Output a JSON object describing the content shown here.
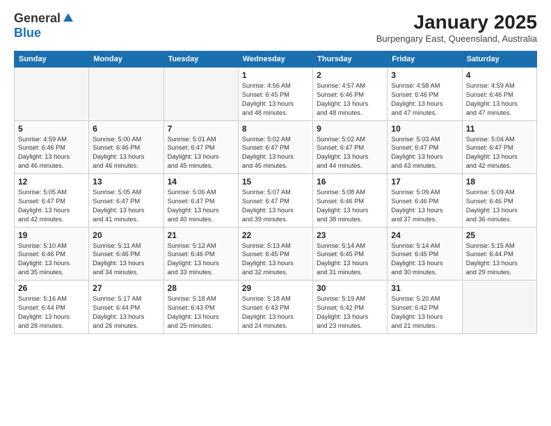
{
  "logo": {
    "general": "General",
    "blue": "Blue"
  },
  "title": "January 2025",
  "location": "Burpengary East, Queensland, Australia",
  "headers": [
    "Sunday",
    "Monday",
    "Tuesday",
    "Wednesday",
    "Thursday",
    "Friday",
    "Saturday"
  ],
  "weeks": [
    [
      {
        "day": "",
        "info": ""
      },
      {
        "day": "",
        "info": ""
      },
      {
        "day": "",
        "info": ""
      },
      {
        "day": "1",
        "info": "Sunrise: 4:56 AM\nSunset: 6:45 PM\nDaylight: 13 hours\nand 48 minutes."
      },
      {
        "day": "2",
        "info": "Sunrise: 4:57 AM\nSunset: 6:46 PM\nDaylight: 13 hours\nand 48 minutes."
      },
      {
        "day": "3",
        "info": "Sunrise: 4:58 AM\nSunset: 6:46 PM\nDaylight: 13 hours\nand 47 minutes."
      },
      {
        "day": "4",
        "info": "Sunrise: 4:59 AM\nSunset: 6:46 PM\nDaylight: 13 hours\nand 47 minutes."
      }
    ],
    [
      {
        "day": "5",
        "info": "Sunrise: 4:59 AM\nSunset: 6:46 PM\nDaylight: 13 hours\nand 46 minutes."
      },
      {
        "day": "6",
        "info": "Sunrise: 5:00 AM\nSunset: 6:46 PM\nDaylight: 13 hours\nand 46 minutes."
      },
      {
        "day": "7",
        "info": "Sunrise: 5:01 AM\nSunset: 6:47 PM\nDaylight: 13 hours\nand 45 minutes."
      },
      {
        "day": "8",
        "info": "Sunrise: 5:02 AM\nSunset: 6:47 PM\nDaylight: 13 hours\nand 45 minutes."
      },
      {
        "day": "9",
        "info": "Sunrise: 5:02 AM\nSunset: 6:47 PM\nDaylight: 13 hours\nand 44 minutes."
      },
      {
        "day": "10",
        "info": "Sunrise: 5:03 AM\nSunset: 6:47 PM\nDaylight: 13 hours\nand 43 minutes."
      },
      {
        "day": "11",
        "info": "Sunrise: 5:04 AM\nSunset: 6:47 PM\nDaylight: 13 hours\nand 42 minutes."
      }
    ],
    [
      {
        "day": "12",
        "info": "Sunrise: 5:05 AM\nSunset: 6:47 PM\nDaylight: 13 hours\nand 42 minutes."
      },
      {
        "day": "13",
        "info": "Sunrise: 5:05 AM\nSunset: 6:47 PM\nDaylight: 13 hours\nand 41 minutes."
      },
      {
        "day": "14",
        "info": "Sunrise: 5:06 AM\nSunset: 6:47 PM\nDaylight: 13 hours\nand 40 minutes."
      },
      {
        "day": "15",
        "info": "Sunrise: 5:07 AM\nSunset: 6:47 PM\nDaylight: 13 hours\nand 39 minutes."
      },
      {
        "day": "16",
        "info": "Sunrise: 5:08 AM\nSunset: 6:46 PM\nDaylight: 13 hours\nand 38 minutes."
      },
      {
        "day": "17",
        "info": "Sunrise: 5:09 AM\nSunset: 6:46 PM\nDaylight: 13 hours\nand 37 minutes."
      },
      {
        "day": "18",
        "info": "Sunrise: 5:09 AM\nSunset: 6:46 PM\nDaylight: 13 hours\nand 36 minutes."
      }
    ],
    [
      {
        "day": "19",
        "info": "Sunrise: 5:10 AM\nSunset: 6:46 PM\nDaylight: 13 hours\nand 35 minutes."
      },
      {
        "day": "20",
        "info": "Sunrise: 5:11 AM\nSunset: 6:46 PM\nDaylight: 13 hours\nand 34 minutes."
      },
      {
        "day": "21",
        "info": "Sunrise: 5:12 AM\nSunset: 6:46 PM\nDaylight: 13 hours\nand 33 minutes."
      },
      {
        "day": "22",
        "info": "Sunrise: 5:13 AM\nSunset: 6:45 PM\nDaylight: 13 hours\nand 32 minutes."
      },
      {
        "day": "23",
        "info": "Sunrise: 5:14 AM\nSunset: 6:45 PM\nDaylight: 13 hours\nand 31 minutes."
      },
      {
        "day": "24",
        "info": "Sunrise: 5:14 AM\nSunset: 6:45 PM\nDaylight: 13 hours\nand 30 minutes."
      },
      {
        "day": "25",
        "info": "Sunrise: 5:15 AM\nSunset: 6:44 PM\nDaylight: 13 hours\nand 29 minutes."
      }
    ],
    [
      {
        "day": "26",
        "info": "Sunrise: 5:16 AM\nSunset: 6:44 PM\nDaylight: 13 hours\nand 28 minutes."
      },
      {
        "day": "27",
        "info": "Sunrise: 5:17 AM\nSunset: 6:44 PM\nDaylight: 13 hours\nand 26 minutes."
      },
      {
        "day": "28",
        "info": "Sunrise: 5:18 AM\nSunset: 6:43 PM\nDaylight: 13 hours\nand 25 minutes."
      },
      {
        "day": "29",
        "info": "Sunrise: 5:18 AM\nSunset: 6:43 PM\nDaylight: 13 hours\nand 24 minutes."
      },
      {
        "day": "30",
        "info": "Sunrise: 5:19 AM\nSunset: 6:42 PM\nDaylight: 13 hours\nand 23 minutes."
      },
      {
        "day": "31",
        "info": "Sunrise: 5:20 AM\nSunset: 6:42 PM\nDaylight: 13 hours\nand 21 minutes."
      },
      {
        "day": "",
        "info": ""
      }
    ]
  ]
}
